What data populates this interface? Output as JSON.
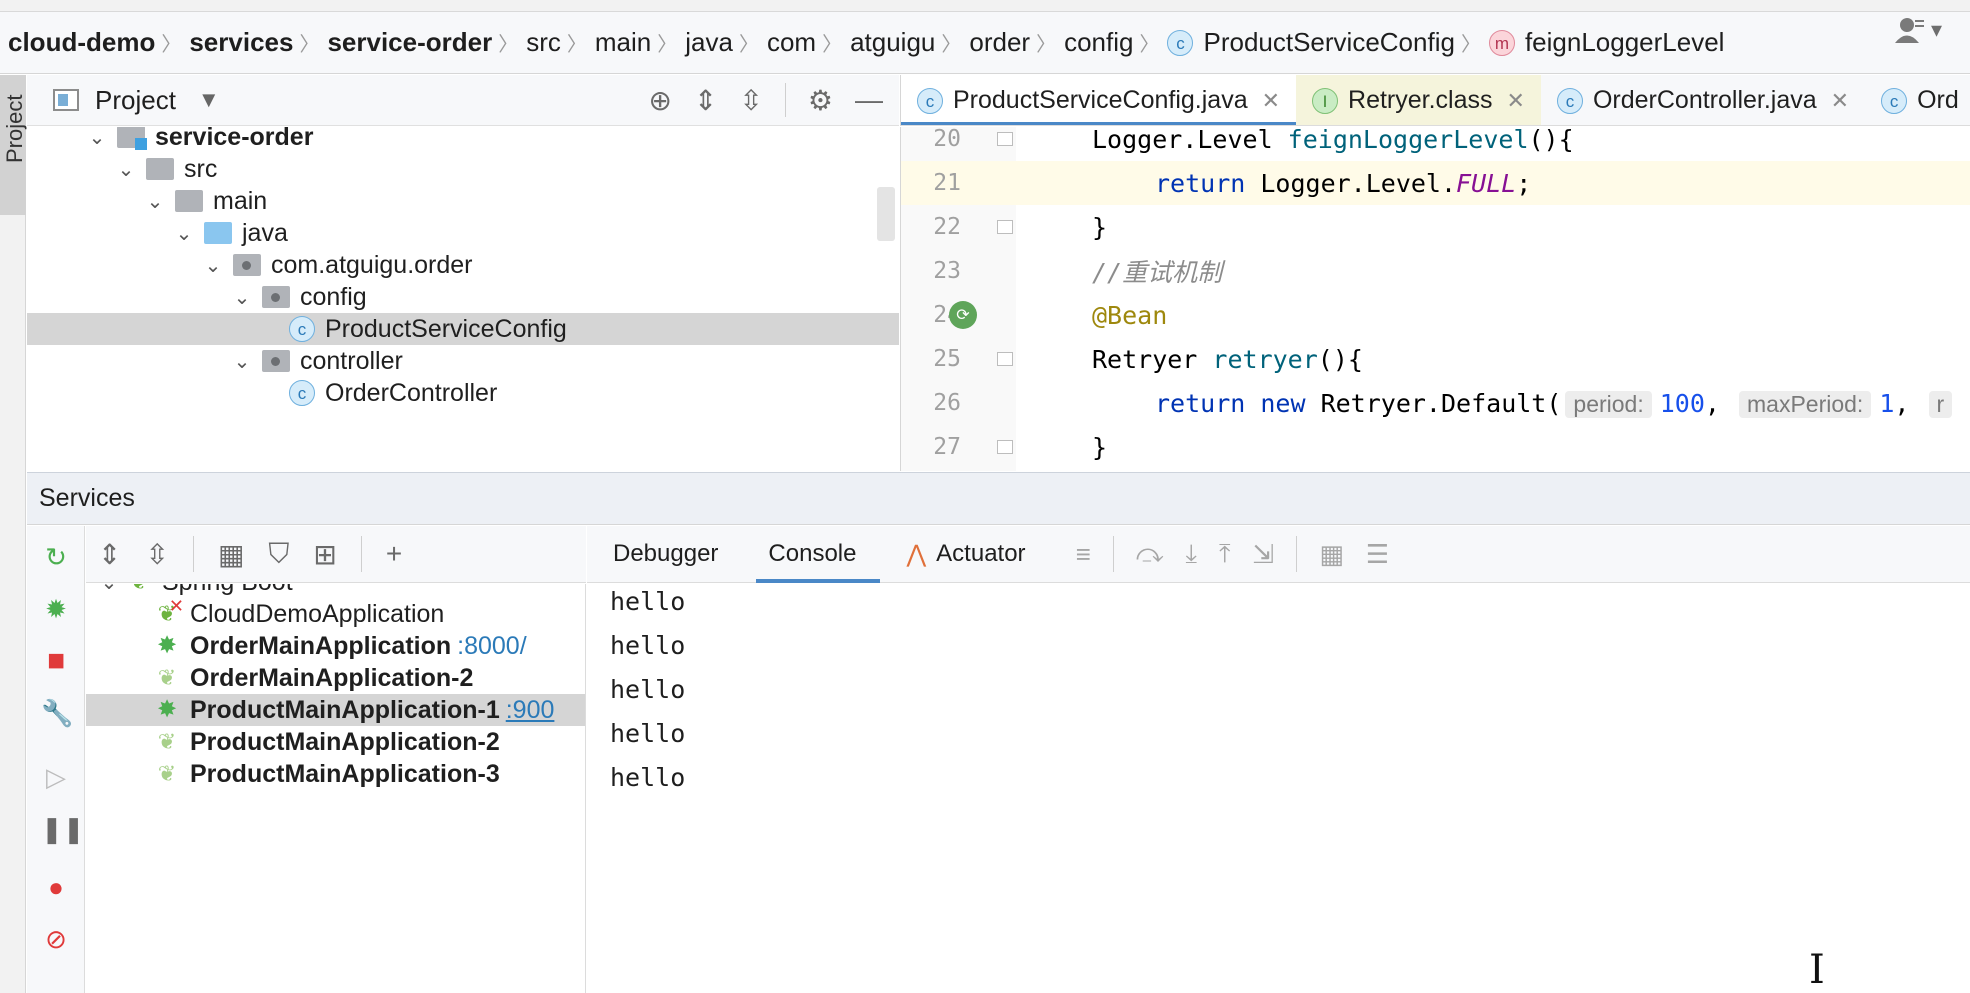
{
  "breadcrumb": [
    {
      "label": "cloud-demo",
      "bold": true,
      "badge": ""
    },
    {
      "label": "services",
      "bold": true,
      "badge": ""
    },
    {
      "label": "service-order",
      "bold": true,
      "badge": ""
    },
    {
      "label": "src",
      "bold": false,
      "badge": ""
    },
    {
      "label": "main",
      "bold": false,
      "badge": ""
    },
    {
      "label": "java",
      "bold": false,
      "badge": ""
    },
    {
      "label": "com",
      "bold": false,
      "badge": ""
    },
    {
      "label": "atguigu",
      "bold": false,
      "badge": ""
    },
    {
      "label": "order",
      "bold": false,
      "badge": ""
    },
    {
      "label": "config",
      "bold": false,
      "badge": ""
    },
    {
      "label": "ProductServiceConfig",
      "bold": false,
      "badge": "c"
    },
    {
      "label": "feignLoggerLevel",
      "bold": false,
      "badge": "m"
    }
  ],
  "project_panel": {
    "title": "Project",
    "stripe_label": "Project",
    "tree": [
      {
        "label": "service-order",
        "depth": 0,
        "kind": "module",
        "expanded": true,
        "bold": true
      },
      {
        "label": "src",
        "depth": 1,
        "kind": "folder",
        "expanded": true
      },
      {
        "label": "main",
        "depth": 2,
        "kind": "folder",
        "expanded": true
      },
      {
        "label": "java",
        "depth": 3,
        "kind": "source",
        "expanded": true
      },
      {
        "label": "com.atguigu.order",
        "depth": 4,
        "kind": "package",
        "expanded": true
      },
      {
        "label": "config",
        "depth": 5,
        "kind": "package",
        "expanded": true
      },
      {
        "label": "ProductServiceConfig",
        "depth": 6,
        "kind": "class",
        "selected": true
      },
      {
        "label": "controller",
        "depth": 5,
        "kind": "package",
        "expanded": true
      },
      {
        "label": "OrderController",
        "depth": 6,
        "kind": "class"
      }
    ]
  },
  "editor": {
    "tabs": [
      {
        "label": "ProductServiceConfig.java",
        "badge": "c",
        "active": true
      },
      {
        "label": "Retryer.class",
        "badge": "i",
        "active": false
      },
      {
        "label": "OrderController.java",
        "badge": "c",
        "active": false
      },
      {
        "label": "Ord",
        "badge": "c",
        "active": false
      }
    ],
    "lines": [
      {
        "num": "20",
        "tokens": [
          [
            "ty",
            "Logger.Level "
          ],
          [
            "fn",
            "feignLoggerLevel"
          ],
          [
            "ty",
            "(){"
          ]
        ],
        "indent": 0
      },
      {
        "num": "21",
        "tokens": [
          [
            "kw",
            "return "
          ],
          [
            "ty",
            "Logger.Level."
          ],
          [
            "it",
            "FULL"
          ],
          [
            "ty",
            ";"
          ]
        ],
        "indent": 1,
        "highlight": true
      },
      {
        "num": "22",
        "tokens": [
          [
            "ty",
            "}"
          ]
        ],
        "indent": 0
      },
      {
        "num": "23",
        "tokens": [
          [
            "cm",
            "//重试机制"
          ]
        ],
        "indent": 0
      },
      {
        "num": "24",
        "tokens": [
          [
            "an",
            "@Bean"
          ]
        ],
        "indent": 0,
        "bean": true
      },
      {
        "num": "25",
        "tokens": [
          [
            "ty",
            "Retryer "
          ],
          [
            "fn",
            "retryer"
          ],
          [
            "ty",
            "(){"
          ]
        ],
        "indent": 0
      },
      {
        "num": "26",
        "tokens": [
          [
            "kw",
            "return new "
          ],
          [
            "ty",
            "Retryer.Default("
          ],
          [
            "hint",
            "period:"
          ],
          [
            "num",
            "100"
          ],
          [
            "ty",
            ", "
          ],
          [
            "hint",
            "maxPeriod:"
          ],
          [
            "num",
            "1"
          ],
          [
            "ty",
            ", "
          ],
          [
            "hint",
            "r"
          ]
        ],
        "indent": 1
      },
      {
        "num": "27",
        "tokens": [
          [
            "ty",
            "}"
          ]
        ],
        "indent": 0
      }
    ]
  },
  "services": {
    "title": "Services",
    "tree": [
      {
        "label": "Spring Boot",
        "depth": 0,
        "icon": "spring-boot-icon",
        "bold": false,
        "port": ""
      },
      {
        "label": "CloudDemoApplication",
        "depth": 1,
        "icon": "failed-run-icon",
        "bold": false,
        "port": ""
      },
      {
        "label": "OrderMainApplication",
        "depth": 1,
        "icon": "debug-icon",
        "bold": true,
        "port": ":8000/"
      },
      {
        "label": "OrderMainApplication-2",
        "depth": 1,
        "icon": "stopped-app-icon",
        "bold": true,
        "port": ""
      },
      {
        "label": "ProductMainApplication-1",
        "depth": 1,
        "icon": "debug-icon",
        "bold": true,
        "port": ":900",
        "selected": true
      },
      {
        "label": "ProductMainApplication-2",
        "depth": 1,
        "icon": "stopped-app-icon",
        "bold": true,
        "port": ""
      },
      {
        "label": "ProductMainApplication-3",
        "depth": 1,
        "icon": "stopped-app-icon",
        "bold": true,
        "port": ""
      }
    ],
    "console_tabs": [
      {
        "label": "Debugger",
        "active": false
      },
      {
        "label": "Console",
        "active": true
      },
      {
        "label": "Actuator",
        "active": false
      }
    ],
    "console_output": [
      "hello",
      "hello",
      "hello",
      "hello",
      "hello"
    ]
  },
  "colors": {
    "accent": "#4a88c7",
    "selection": "#d5d5d5",
    "line_highlight": "#fffbe8",
    "keyword": "#0033b3",
    "method": "#00627a",
    "annotation": "#9e880d",
    "spring_green": "#6db33f"
  }
}
